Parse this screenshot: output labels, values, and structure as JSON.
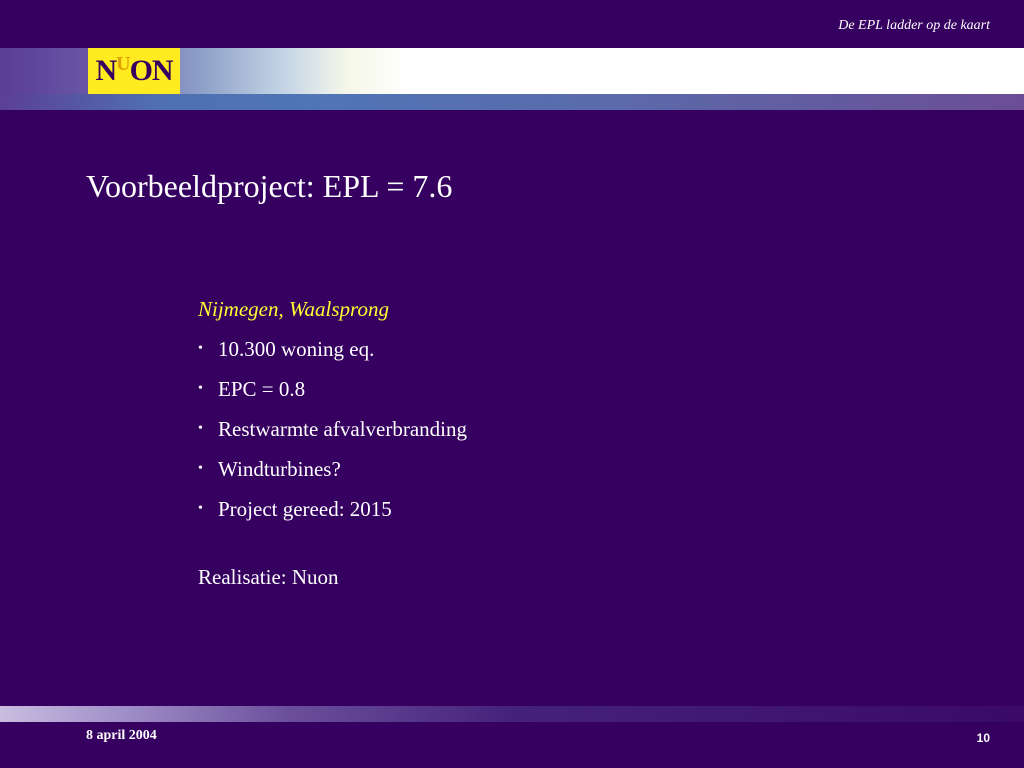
{
  "header": {
    "caption": "De EPL ladder op de kaart"
  },
  "logo": {
    "text_left": "N",
    "text_u": "U",
    "text_right": "ON"
  },
  "slide": {
    "title": "Voorbeeldproject:  EPL = 7.6",
    "subheading": "Nijmegen, Waalsprong",
    "bullet_symbol": "•",
    "bullets": [
      "10.300 woning eq.",
      "EPC = 0.8",
      "Restwarmte afvalverbranding",
      "Windturbines?",
      "Project gereed: 2015"
    ],
    "realisatie": "Realisatie: Nuon"
  },
  "footer": {
    "date": "8 april 2004",
    "page_number": "10"
  },
  "colors": {
    "background": "#350060",
    "logo_background": "#ffeb1f",
    "subheading": "#ffff33",
    "text": "#ffffff"
  }
}
